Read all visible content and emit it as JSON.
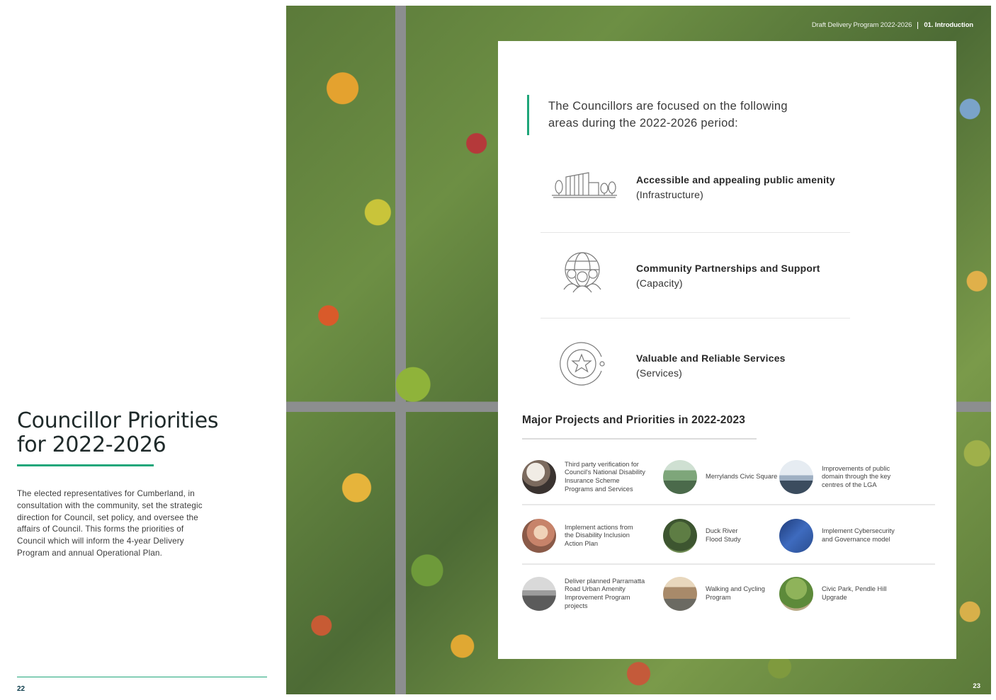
{
  "left_page": {
    "title_line1": "Councillor Priorities",
    "title_line2": "for 2022-2026",
    "body": "The elected representatives for Cumberland, in consultation with the community, set the strategic direction for Council, set policy, and oversee the affairs of Council. This forms the priorities of Council which will inform the 4-year Delivery Program and annual Operational Plan.",
    "page_number": "22"
  },
  "right_page": {
    "header": {
      "document_title": "Draft Delivery Program 2022-2026",
      "section": "01. Introduction"
    },
    "page_number": "23",
    "intro": "The Councillors are focused on the following areas during the 2022-2026 period:",
    "priorities": [
      {
        "title": "Accessible and appealing public amenity",
        "subtitle": "(Infrastructure)",
        "icon": "infrastructure-icon"
      },
      {
        "title": "Community Partnerships and Support",
        "subtitle": "(Capacity)",
        "icon": "community-globe-icon"
      },
      {
        "title": "Valuable and Reliable Services",
        "subtitle": "(Services)",
        "icon": "star-badge-icon"
      }
    ],
    "projects_heading": "Major Projects and Priorities in 2022-2023",
    "projects": [
      {
        "label": "Third party verification for Council's National Disability Insurance Scheme Programs and Services"
      },
      {
        "label": "Merrylands Civic Square"
      },
      {
        "label": "Improvements of public domain through the key centres of the LGA"
      },
      {
        "label": "Implement actions from the Disability Inclusion Action Plan"
      },
      {
        "label": "Duck River Flood Study"
      },
      {
        "label": "Implement Cybersecurity and Governance model"
      },
      {
        "label": "Deliver planned Parramatta Road Urban Amenity Improvement Program projects"
      },
      {
        "label": "Walking and Cycling Program"
      },
      {
        "label": "Civic Park, Pendle Hill Upgrade"
      }
    ]
  },
  "colors": {
    "accent_green": "#1fa67a",
    "page_number_navy": "#0b3b4a"
  }
}
